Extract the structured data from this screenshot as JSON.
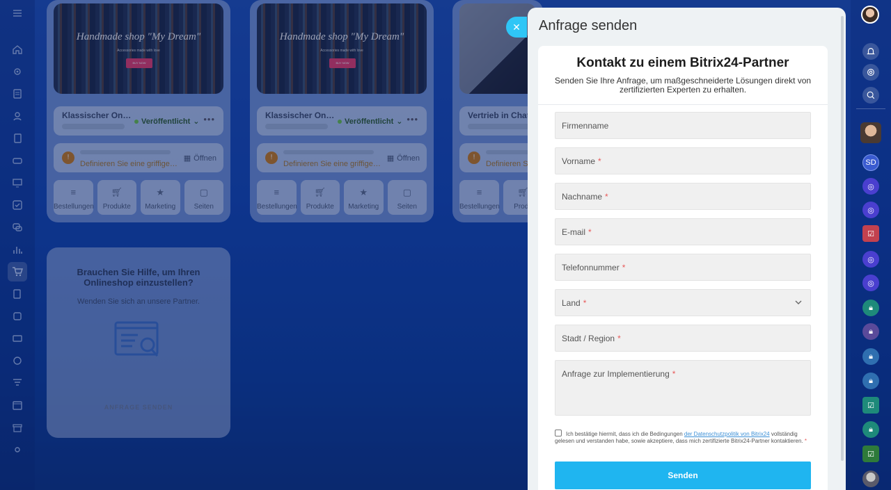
{
  "background_shop": {
    "cards": [
      {
        "image_title": "Handmade shop \"My Dream\"",
        "image_subtitle": "Accessories made with love",
        "image_button": "BUY NOW",
        "name": "Klassischer Onli...",
        "status": "Veröffentlicht",
        "domain_hint": "Definieren Sie eine griffige ...",
        "open_label": "Öffnen",
        "tiles": [
          "Bestellungen",
          "Produkte",
          "Marketing",
          "Seiten"
        ]
      },
      {
        "image_title": "Handmade shop \"My Dream\"",
        "image_subtitle": "Accessories made with love",
        "image_button": "BUY NOW",
        "name": "Klassischer Onli...",
        "status": "Veröffentlicht",
        "domain_hint": "Definieren Sie eine griffige ...",
        "open_label": "Öffnen",
        "tiles": [
          "Bestellungen",
          "Produkte",
          "Marketing",
          "Seiten"
        ]
      },
      {
        "name": "Vertrieb in Chat",
        "domain_hint": "Definieren Si",
        "tiles": [
          "Bestellungen",
          "Produ"
        ]
      }
    ],
    "help": {
      "title": "Brauchen Sie Hilfe, um Ihren Onlineshop einzustellen?",
      "subtitle": "Wenden Sie sich an unsere Partner.",
      "button": "ANFRAGE SENDEN"
    }
  },
  "dialog": {
    "panel_title": "Anfrage senden",
    "close_icon": "close-icon",
    "form_title": "Kontakt zu einem Bitrix24-Partner",
    "form_subtitle": "Senden Sie Ihre Anfrage, um maßgeschneiderte Lösungen direkt von zertifizierten Experten zu erhalten.",
    "fields": {
      "company": {
        "placeholder": "Firmenname",
        "required": ""
      },
      "first_name": {
        "placeholder": "Vorname",
        "required": "*"
      },
      "last_name": {
        "placeholder": "Nachname",
        "required": "*"
      },
      "email": {
        "placeholder": "E-mail",
        "required": "*"
      },
      "phone": {
        "placeholder": "Telefonnummer",
        "required": "*"
      },
      "country": {
        "placeholder": "Land",
        "required": "*"
      },
      "city": {
        "placeholder": "Stadt / Region",
        "required": "*"
      },
      "request": {
        "placeholder": "Anfrage zur Implementierung",
        "required": "*"
      }
    },
    "consent": {
      "text_before": "Ich bestätige hiermit, dass ich die Bedingungen ",
      "link": "der Datenschutzpolitik von Bitrix24",
      "text_after": " vollständig gelesen und verstanden habe, sowie akzeptiere, dass mich zertifizierte Bitrix24-Partner kontaktieren.",
      "required": "*"
    },
    "submit_label": "Senden"
  },
  "right_bar": {
    "items": [
      "SD"
    ]
  },
  "colors": {
    "accent": "#2fc6f6",
    "submit": "#1fb5f0",
    "required": "#e85959",
    "link": "#3b8fd6"
  }
}
